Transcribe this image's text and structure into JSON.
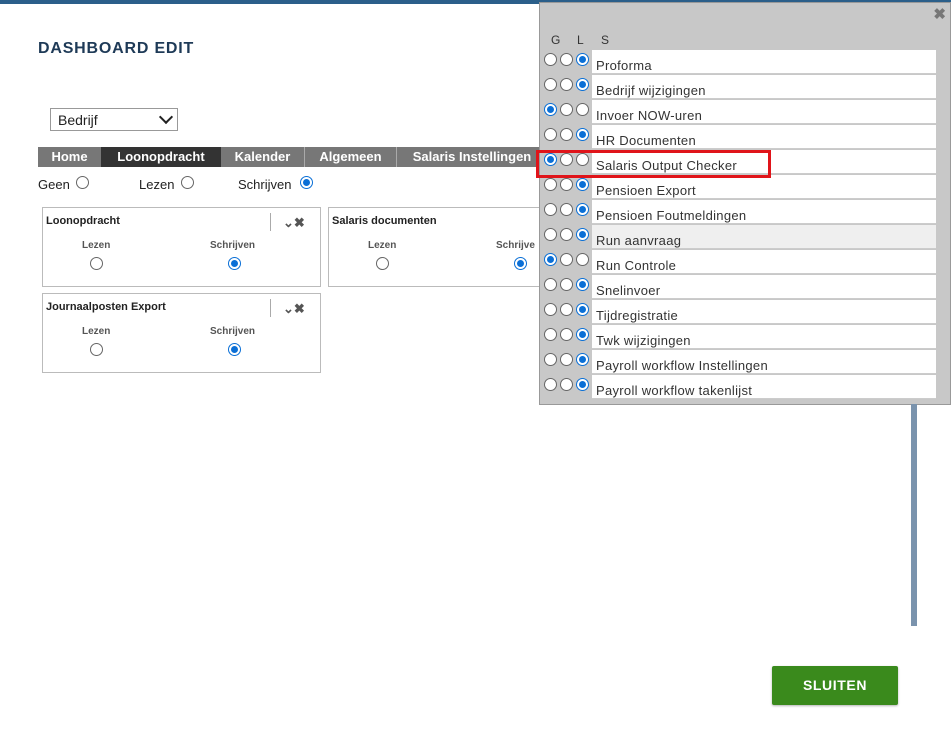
{
  "page_title": "DASHBOARD EDIT",
  "company_select": {
    "value": "Bedrijf"
  },
  "tabs": [
    "Home",
    "Loonopdracht",
    "Kalender",
    "Algemeen",
    "Salaris Instellingen"
  ],
  "active_tab": "Loonopdracht",
  "permissions": {
    "geen": "Geen",
    "lezen": "Lezen",
    "schrijven": "Schrijven",
    "selected": "schrijven"
  },
  "widgets": [
    {
      "title": "Loonopdracht",
      "lezen": "Lezen",
      "schrijven": "Schrijven",
      "selected": "schrijven"
    },
    {
      "title": "Salaris documenten",
      "lezen": "Lezen",
      "schrijven": "Schrijve",
      "selected": "schrijven"
    },
    {
      "title": "Journaalposten Export",
      "lezen": "Lezen",
      "schrijven": "Schrijven",
      "selected": "schrijven"
    }
  ],
  "widget_icons": {
    "collapse": "chevron-down-icon",
    "remove": "close-icon"
  },
  "panel": {
    "close_icon": "close-icon",
    "headers": {
      "g": "G",
      "l": "L",
      "s": "S"
    },
    "items": [
      {
        "label": "Proforma",
        "selected": "S"
      },
      {
        "label": "Bedrijf wijzigingen",
        "selected": "S"
      },
      {
        "label": "Invoer NOW-uren",
        "selected": "G"
      },
      {
        "label": "HR Documenten",
        "selected": "S"
      },
      {
        "label": "Salaris Output Checker",
        "selected": "G"
      },
      {
        "label": "Pensioen Export",
        "selected": "S"
      },
      {
        "label": "Pensioen Foutmeldingen",
        "selected": "S"
      },
      {
        "label": "Run aanvraag",
        "selected": "S"
      },
      {
        "label": "Run Controle",
        "selected": "G"
      },
      {
        "label": "Snelinvoer",
        "selected": "S"
      },
      {
        "label": "Tijdregistratie",
        "selected": "S"
      },
      {
        "label": "Twk wijzigingen",
        "selected": "S"
      },
      {
        "label": "Payroll workflow Instellingen",
        "selected": "S"
      },
      {
        "label": "Payroll workflow takenlijst",
        "selected": "S"
      }
    ],
    "highlighted_item": "Salaris Output Checker"
  },
  "close_button": "SLUITEN",
  "colors": {
    "accent": "#0a6fd6",
    "button": "#3a8a1c",
    "highlight": "#e0141a",
    "title": "#1e3a57"
  }
}
